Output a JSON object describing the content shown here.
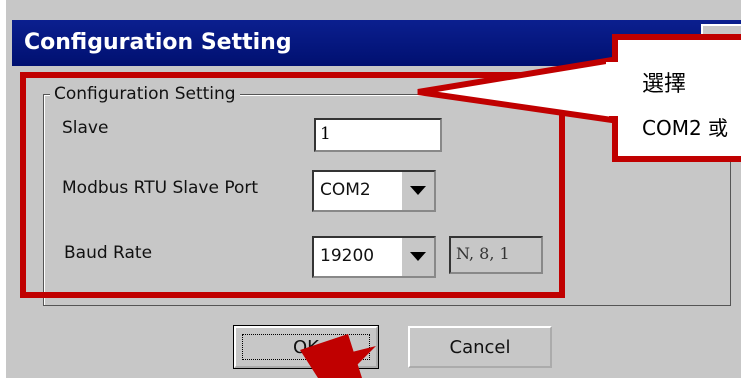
{
  "window": {
    "title": "Configuration Setting"
  },
  "group": {
    "legend": "Configuration Setting"
  },
  "fields": {
    "slave": {
      "label": "Slave",
      "value": "1"
    },
    "port": {
      "label": "Modbus RTU Slave Port",
      "value": "COM2"
    },
    "baud": {
      "label": "Baud Rate",
      "value": "19200",
      "format": "N, 8, 1"
    }
  },
  "buttons": {
    "ok": "OK",
    "cancel": "Cancel"
  },
  "callout": {
    "line1": "選擇",
    "line2": "COM2 或"
  },
  "colors": {
    "highlight": "#c00000",
    "title_bar": "#0b1f8f"
  }
}
